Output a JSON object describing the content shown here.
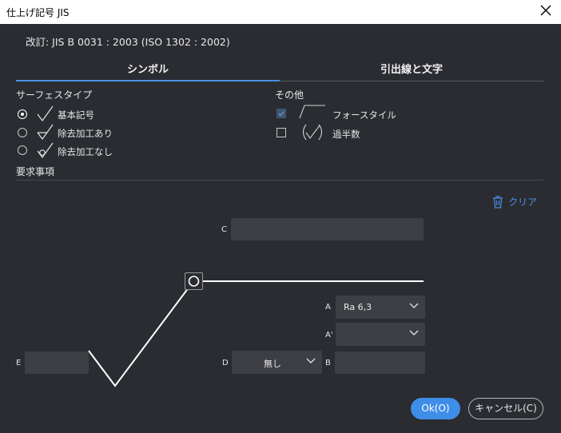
{
  "window": {
    "title": "仕上げ記号 JIS"
  },
  "revision": "改訂: JIS B 0031 : 2003 (ISO 1302 : 2002)",
  "tabs": [
    {
      "label": "シンボル",
      "active": true
    },
    {
      "label": "引出線と文字",
      "active": false
    }
  ],
  "surface_type": {
    "heading": "サーフェスタイプ",
    "options": [
      {
        "label": "基本記号",
        "selected": true
      },
      {
        "label": "除去加工あり",
        "selected": false
      },
      {
        "label": "除去加工なし",
        "selected": false
      }
    ]
  },
  "other": {
    "heading": "その他",
    "options": [
      {
        "label": "フォースタイル",
        "checked": true,
        "disabled": true
      },
      {
        "label": "過半数",
        "checked": false,
        "disabled": false
      }
    ]
  },
  "requirements": {
    "heading": "要求事項",
    "clear_label": "クリア"
  },
  "fields": {
    "c_label": "C",
    "a_label": "A",
    "a_value": "Ra 6,3",
    "a_prime_label": "A'",
    "a_prime_value": "",
    "b_label": "B",
    "d_label": "D",
    "d_value": "無し",
    "e_label": "E"
  },
  "buttons": {
    "ok": "Ok(O)",
    "cancel": "キャンセル(C)"
  },
  "colors": {
    "accent": "#4a8fe7",
    "background": "#2a2c31",
    "field": "#3d3f44"
  }
}
